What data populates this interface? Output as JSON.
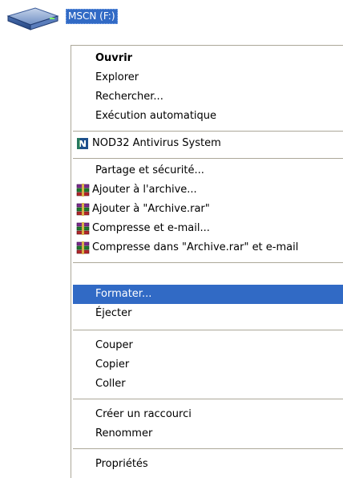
{
  "drive": {
    "label": "MSCN (F:)",
    "icon": "drive-icon"
  },
  "menu": {
    "items": [
      {
        "label": "Ouvrir",
        "bold": true
      },
      {
        "label": "Explorer"
      },
      {
        "label": "Rechercher..."
      },
      {
        "label": "Exécution automatique"
      },
      {
        "label": "NOD32 Antivirus System",
        "icon": "nod32-icon"
      },
      {
        "label": "Partage et sécurité..."
      },
      {
        "label": "Ajouter à l'archive...",
        "icon": "winrar-icon"
      },
      {
        "label": "Ajouter à \"Archive.rar\"",
        "icon": "winrar-icon"
      },
      {
        "label": "Compresse et e-mail...",
        "icon": "winrar-icon"
      },
      {
        "label": "Compresse dans \"Archive.rar\" et e-mail",
        "icon": "winrar-icon"
      },
      {
        "label": "Formater...",
        "selected": true
      },
      {
        "label": "Éjecter"
      },
      {
        "label": "Couper"
      },
      {
        "label": "Copier"
      },
      {
        "label": "Coller"
      },
      {
        "label": "Créer un raccourci"
      },
      {
        "label": "Renommer"
      },
      {
        "label": "Propriétés"
      }
    ]
  },
  "colors": {
    "selection": "#316ac5",
    "separator": "#aca899"
  }
}
